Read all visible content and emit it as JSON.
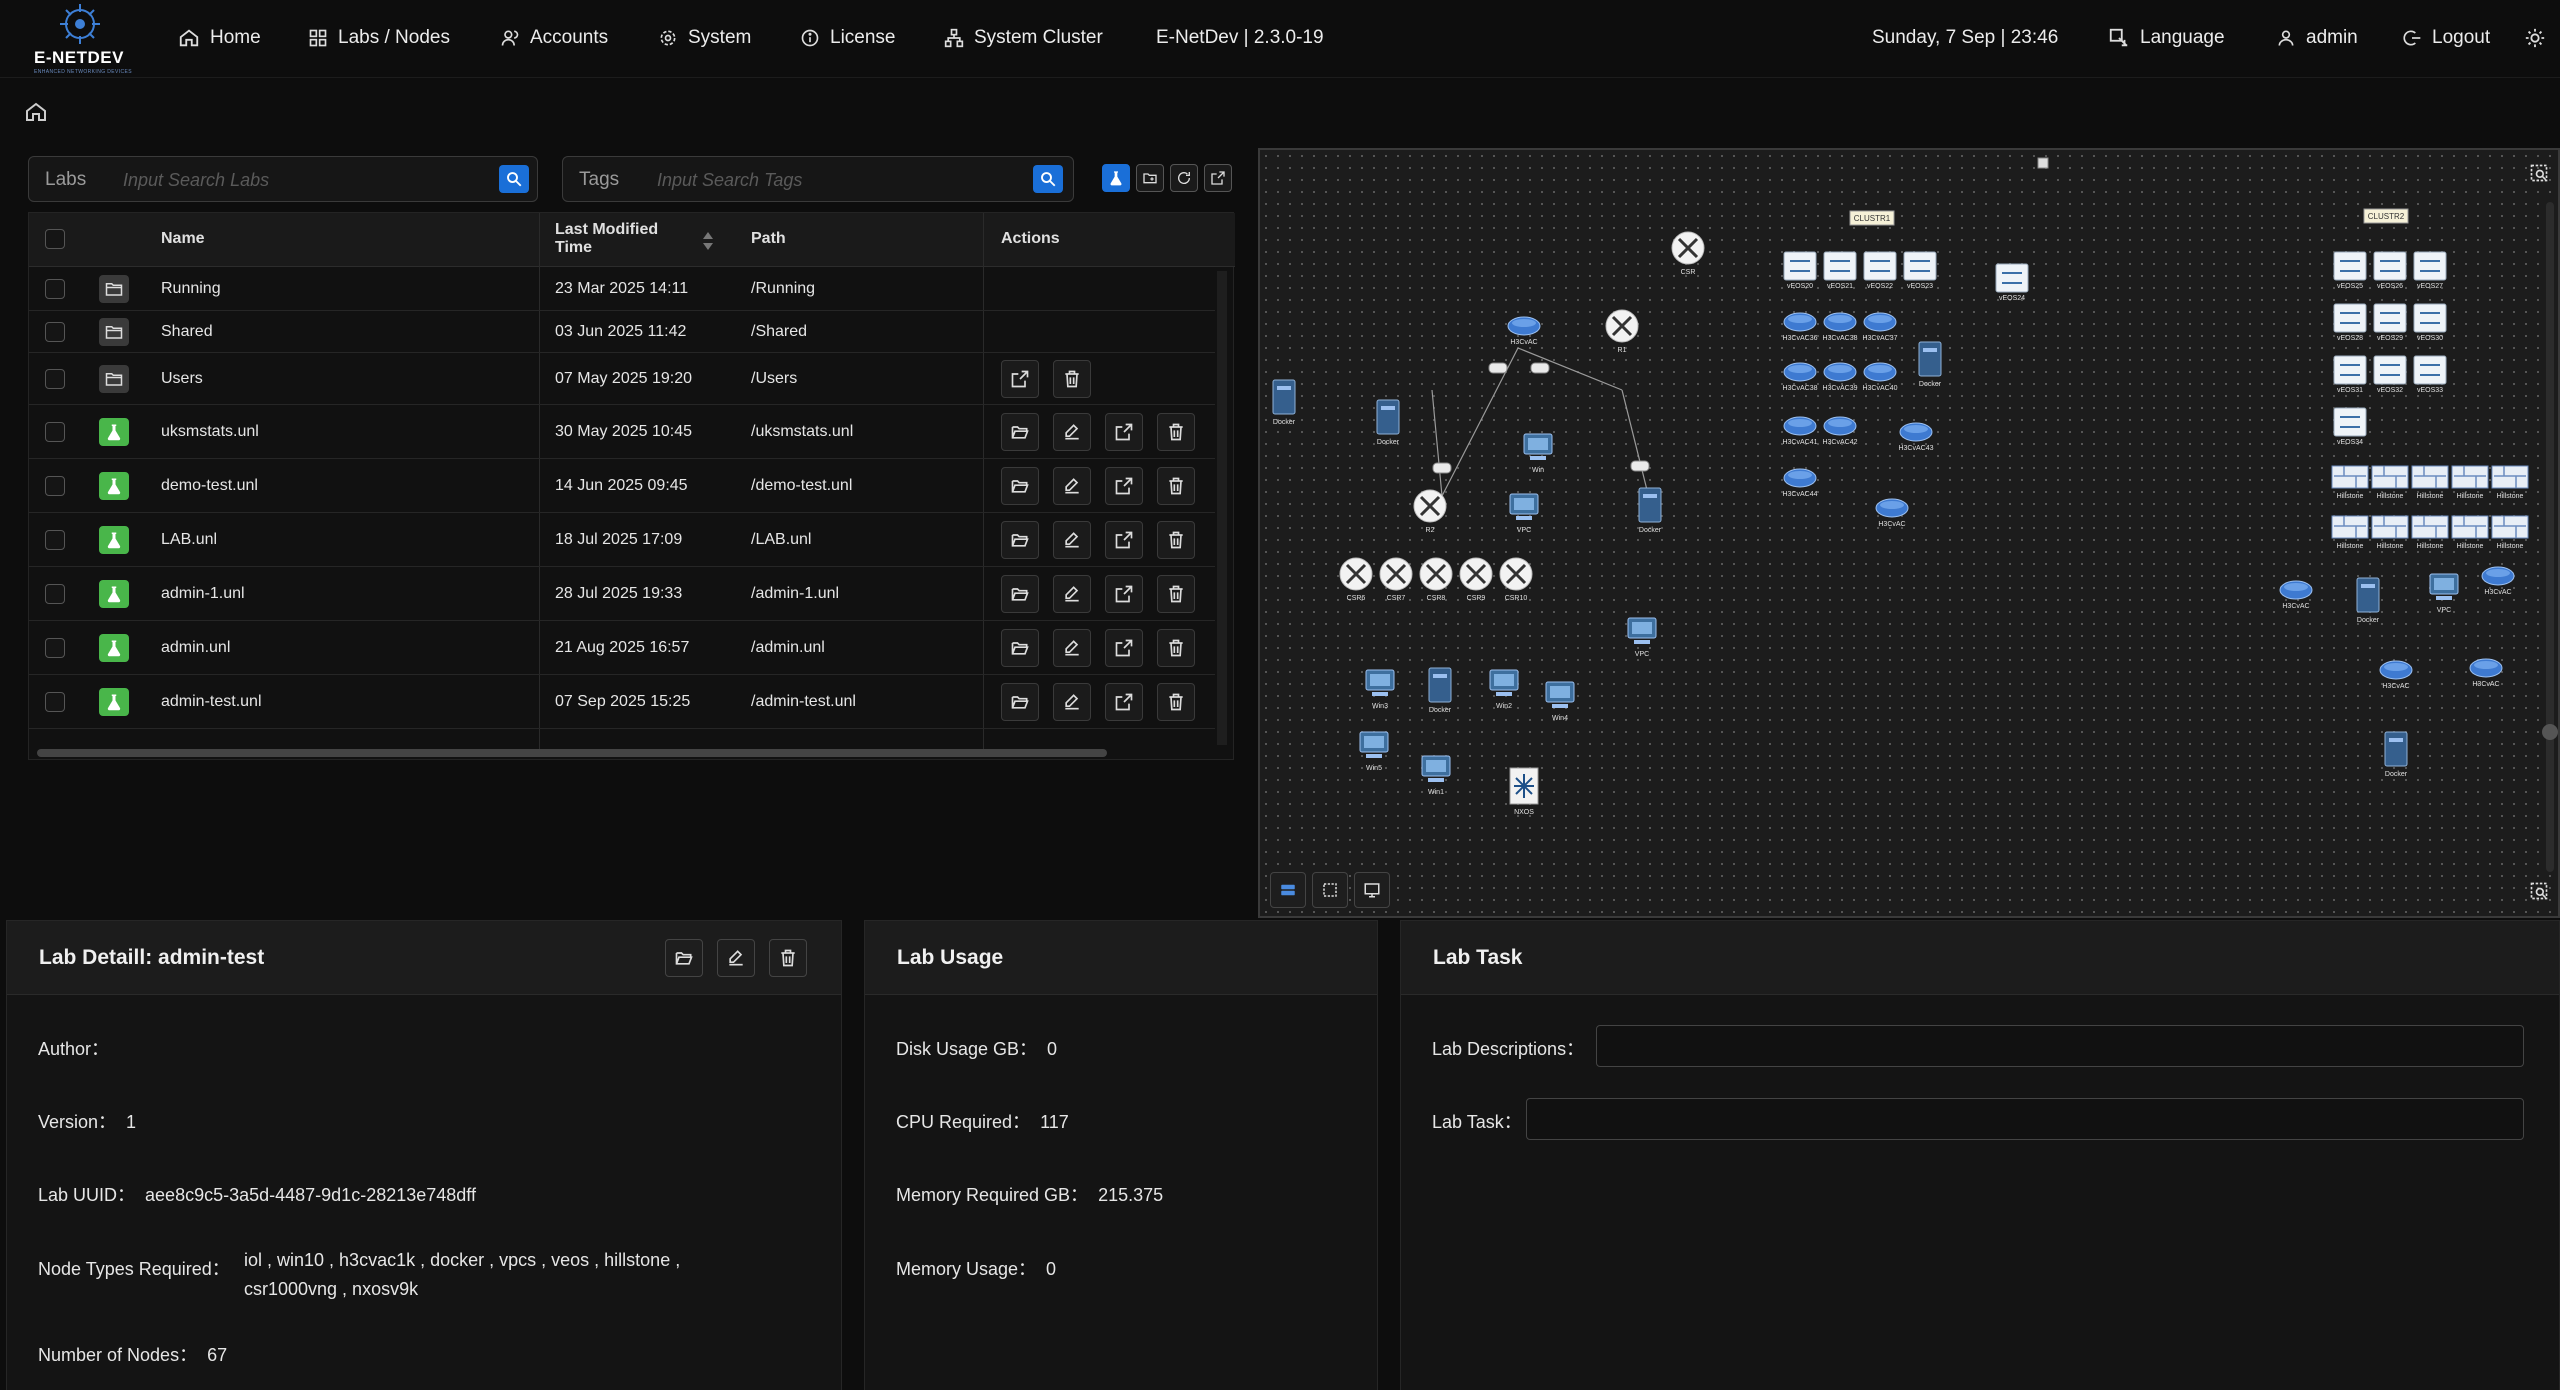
{
  "app": {
    "brand": "E-NETDEV",
    "tagline": "ENHANCED NETWORKING DEVICES"
  },
  "nav": {
    "home": "Home",
    "labs_nodes": "Labs / Nodes",
    "accounts": "Accounts",
    "system": "System",
    "license": "License",
    "system_cluster": "System Cluster",
    "version": "E-NetDev | 2.3.0-19",
    "datetime": "Sunday, 7 Sep | 23:46",
    "language": "Language",
    "user": "admin",
    "logout": "Logout"
  },
  "search": {
    "labs_label": "Labs",
    "labs_placeholder": "Input Search Labs",
    "tags_label": "Tags",
    "tags_placeholder": "Input Search Tags"
  },
  "table": {
    "headers": {
      "name": "Name",
      "modified_line1": "Last Modified",
      "modified_line2": "Time",
      "path": "Path",
      "actions": "Actions"
    },
    "rows": [
      {
        "type": "folder",
        "name": "Running",
        "modified": "23 Mar 2025 14:11",
        "path": "/Running"
      },
      {
        "type": "folder",
        "name": "Shared",
        "modified": "03 Jun 2025 11:42",
        "path": "/Shared"
      },
      {
        "type": "folder",
        "name": "Users",
        "modified": "07 May 2025 19:20",
        "path": "/Users"
      },
      {
        "type": "lab",
        "name": "uksmstats.unl",
        "modified": "30 May 2025 10:45",
        "path": "/uksmstats.unl"
      },
      {
        "type": "lab",
        "name": "demo-test.unl",
        "modified": "14 Jun 2025 09:45",
        "path": "/demo-test.unl"
      },
      {
        "type": "lab",
        "name": "LAB.unl",
        "modified": "18 Jul 2025 17:09",
        "path": "/LAB.unl"
      },
      {
        "type": "lab",
        "name": "admin-1.unl",
        "modified": "28 Jul 2025 19:33",
        "path": "/admin-1.unl"
      },
      {
        "type": "lab",
        "name": "admin.unl",
        "modified": "21 Aug 2025 16:57",
        "path": "/admin.unl"
      },
      {
        "type": "lab",
        "name": "admin-test.unl",
        "modified": "07 Sep 2025 15:25",
        "path": "/admin-test.unl"
      }
    ]
  },
  "topology": {
    "cluster_labels": [
      "CLUSTR1",
      "CLUSTR2"
    ],
    "node_labels": {
      "csr": "CSR",
      "r1": "R1",
      "r2": "R2",
      "h3c": "H3CvAC",
      "docker": "Docker",
      "win": "Win",
      "vpc": "VPC",
      "csr6": "CSR6",
      "csr7": "CSR7",
      "csr8": "CSR8",
      "csr9": "CSR9",
      "csr10": "CSR10",
      "win1": "Win1",
      "win2": "Win2",
      "win3": "Win3",
      "win4": "Win4",
      "win5": "Win5",
      "nxos": "NXOS",
      "veos20": "vEOS20",
      "veos21": "vEOS21",
      "veos22": "vEOS22",
      "veos23": "vEOS23",
      "veos24": "vEOS24",
      "veos25": "vEOS25",
      "veos26": "vEOS26",
      "veos27": "vEOS27",
      "veos28": "vEOS28",
      "veos29": "vEOS29",
      "veos30": "vEOS30",
      "veos31": "vEOS31",
      "veos32": "vEOS32",
      "veos33": "vEOS33",
      "veos34": "vEOS34",
      "h3c36": "H3CvAC36",
      "h3c38": "H3CvAC38",
      "h3c37": "H3CvAC37",
      "h3c39": "H3CvAC39",
      "h3c40": "H3CvAC40",
      "h3c41": "H3CvAC41",
      "h3c42": "H3CvAC42",
      "h3c43": "H3CvAC43",
      "h3c44": "H3CvAC44",
      "hillstone": "Hillstone"
    }
  },
  "lab_detail": {
    "title": "Lab Detaill: admin-test",
    "author_label": "Author：",
    "author": "",
    "version_label": "Version：",
    "version": "1",
    "uuid_label": "Lab UUID：",
    "uuid": "aee8c9c5-3a5d-4487-9d1c-28213e748dff",
    "node_types_label": "Node Types Required：",
    "node_types": "iol , win10 , h3cvac1k , docker , vpcs , veos , hillstone , csr1000vng , nxosv9k",
    "nodes_label": "Number of Nodes：",
    "nodes": "67"
  },
  "lab_usage": {
    "title": "Lab Usage",
    "disk_label": "Disk Usage GB：",
    "disk": "0",
    "cpu_label": "CPU Required：",
    "cpu": "117",
    "mem_req_label": "Memory Required GB：",
    "mem_req": "215.375",
    "mem_use_label": "Memory Usage：",
    "mem_use": "0"
  },
  "lab_task": {
    "title": "Lab Task",
    "descriptions_label": "Lab Descriptions：",
    "descriptions_value": "",
    "task_label": "Lab Task：",
    "task_value": ""
  },
  "colors": {
    "accent": "#1a6fd8",
    "lab_icon": "#49b64a",
    "background": "#0d0d0d"
  }
}
